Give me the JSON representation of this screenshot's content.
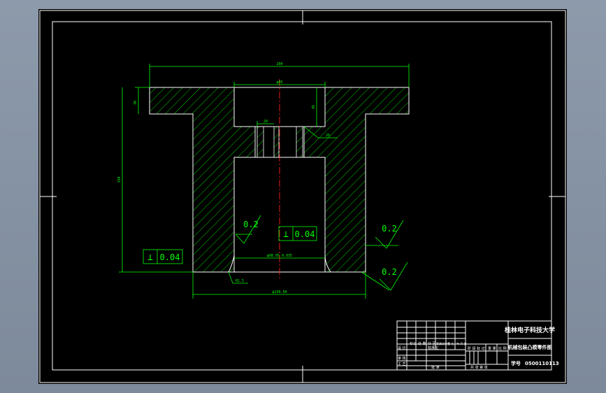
{
  "colors": {
    "background": "#000000",
    "outline": "#ffffff",
    "dimension": "#00ff00",
    "centerline": "#ff2020"
  },
  "dimensions": {
    "top_width": "200",
    "bore_width": "φ95",
    "flange_height": "30",
    "counterbore_depth": "45",
    "small_hole": "20",
    "hole_depth": "20",
    "overall_height": "150",
    "bore_bottom": "φ98.05 0.035",
    "base_width": "φ130.5H",
    "fillet": "R1.5"
  },
  "tolerances": {
    "left_symbol": "⊥",
    "left_value": "0.04",
    "center_symbol": "⊥",
    "center_value": "0.04"
  },
  "roughness": {
    "left": "0.2",
    "right_upper": "0.2",
    "right_lower": "0.2"
  },
  "title_block": {
    "school": "桂林电子科技大学",
    "drawing_name": "机械包装凸模零件图",
    "number_label": "学号",
    "number_value": "0500110113",
    "stage_labels": "阶 段 标 记",
    "weight": "重 量",
    "scale": "比 例",
    "row_labels": [
      "标记",
      "处 数",
      "分 区",
      "更改文件号",
      "签 名",
      "年 月 日"
    ],
    "design": "设 计",
    "standard": "标准化",
    "review": "审 核",
    "process": "工 艺",
    "approve": "批 准",
    "sheet": "共 张 第 张"
  }
}
